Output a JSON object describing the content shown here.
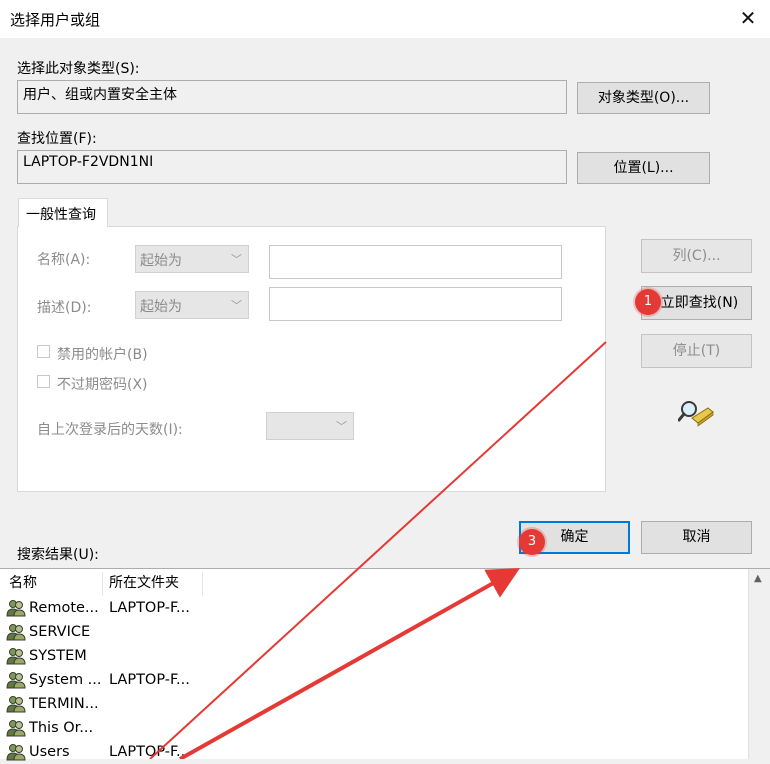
{
  "window": {
    "title": "选择用户或组",
    "close_glyph": "✕"
  },
  "object_type": {
    "label": "选择此对象类型(S):",
    "value": "用户、组或内置安全主体",
    "button": "对象类型(O)..."
  },
  "location": {
    "label": "查找位置(F):",
    "value": "LAPTOP-F2VDN1NI",
    "button": "位置(L)..."
  },
  "query_tab": {
    "label": "一般性查询",
    "name_label": "名称(A):",
    "name_mode": "起始为",
    "desc_label": "描述(D):",
    "desc_mode": "起始为",
    "disabled_accounts": "禁用的帐户(B)",
    "non_expiring_pwd": "不过期密码(X)",
    "days_since_login": "自上次登录后的天数(I):",
    "days_value": ""
  },
  "side_buttons": {
    "columns": "列(C)...",
    "find_now": "立即查找(N)",
    "stop": "停止(T)"
  },
  "footer_buttons": {
    "ok": "确定",
    "cancel": "取消"
  },
  "results": {
    "label": "搜索结果(U):",
    "columns": [
      "名称",
      "所在文件夹"
    ],
    "rows": [
      {
        "name": "Remote...",
        "folder": "LAPTOP-F..."
      },
      {
        "name": "SERVICE",
        "folder": ""
      },
      {
        "name": "SYSTEM",
        "folder": ""
      },
      {
        "name": "System ...",
        "folder": "LAPTOP-F..."
      },
      {
        "name": "TERMIN...",
        "folder": ""
      },
      {
        "name": "This Or...",
        "folder": ""
      },
      {
        "name": "Users",
        "folder": "LAPTOP-F..."
      }
    ]
  },
  "annotations": {
    "step1": "1",
    "step3": "3",
    "arrow_color": "#e53935"
  },
  "colors": {
    "accent": "#0078d7",
    "annotation_red": "#e53935"
  },
  "icons": {
    "search_icon": "search-directory-icon",
    "user_icon": "user-group-icon"
  }
}
